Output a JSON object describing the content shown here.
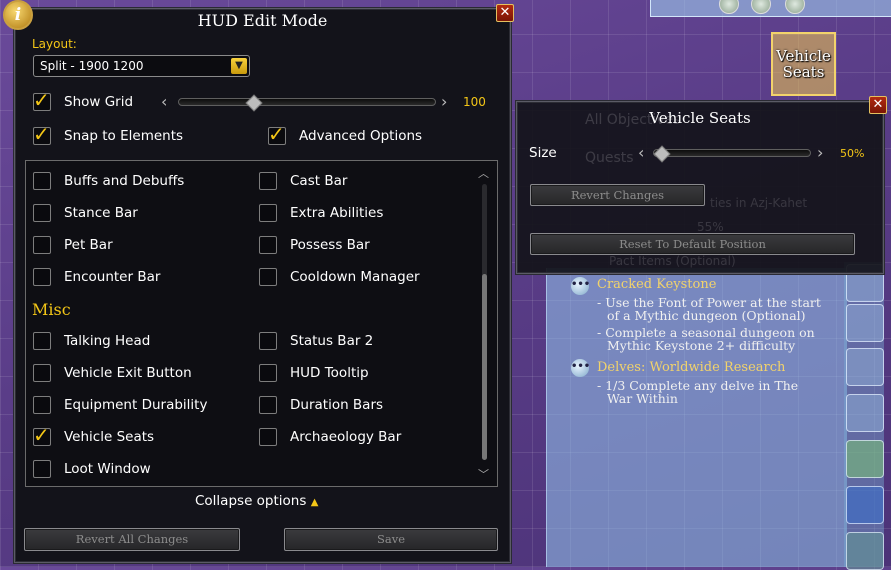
{
  "hud_panel": {
    "title": "HUD Edit Mode",
    "info_icon": "i",
    "close_icon": "✕",
    "layout_label": "Layout:",
    "layout_value": "Split - 1900 1200",
    "show_grid": {
      "label": "Show Grid",
      "checked": true,
      "value": "100",
      "level_fraction": 0.29
    },
    "snap_to_elements": {
      "label": "Snap to Elements",
      "checked": true
    },
    "advanced_options": {
      "label": "Advanced Options",
      "checked": true
    },
    "options_left": [
      {
        "label": "Buffs and Debuffs",
        "checked": false
      },
      {
        "label": "Stance Bar",
        "checked": false
      },
      {
        "label": "Pet Bar",
        "checked": false
      },
      {
        "label": "Encounter Bar",
        "checked": false
      }
    ],
    "options_right": [
      {
        "label": "Cast Bar",
        "checked": false
      },
      {
        "label": "Extra Abilities",
        "checked": false
      },
      {
        "label": "Possess Bar",
        "checked": false
      },
      {
        "label": "Cooldown Manager",
        "checked": false
      }
    ],
    "misc_heading": "Misc",
    "misc_left": [
      {
        "label": "Talking Head",
        "checked": false
      },
      {
        "label": "Vehicle Exit Button",
        "checked": false
      },
      {
        "label": "Equipment Durability",
        "checked": false
      },
      {
        "label": "Vehicle Seats",
        "checked": true
      },
      {
        "label": "Loot Window",
        "checked": false
      }
    ],
    "misc_right": [
      {
        "label": "Status Bar 2",
        "checked": false
      },
      {
        "label": "HUD Tooltip",
        "checked": false
      },
      {
        "label": "Duration Bars",
        "checked": false
      },
      {
        "label": "Archaeology Bar",
        "checked": false
      }
    ],
    "collapse_label": "Collapse options",
    "collapse_icon": "▲",
    "revert_all_label": "Revert All Changes",
    "save_label": "Save"
  },
  "vehicle_panel": {
    "title": "Vehicle Seats",
    "size_label": "Size",
    "size_value": "50%",
    "size_fraction": 0.0,
    "revert_label": "Revert Changes",
    "reset_label": "Reset To Default Position",
    "close_icon": "✕",
    "ghost_text_1": "All Objectives",
    "ghost_text_2": "Quests",
    "ghost_text_3": "ties in Azj-Kahet",
    "ghost_text_4": "55%",
    "ghost_text_5": "Pact Items (Optional)"
  },
  "widget": {
    "line1": "Vehicle",
    "line2": "Seats"
  },
  "tracker": {
    "items": [
      {
        "title": "Cracked Keystone",
        "lines": [
          "- Use the Font of Power at the start",
          "of a Mythic dungeon (Optional)",
          "- Complete a seasonal dungeon on",
          "Mythic Keystone 2+ difficulty"
        ]
      },
      {
        "title": "Delves: Worldwide Research",
        "lines": [
          "- 1/3 Complete any delve in The",
          "War Within"
        ]
      }
    ]
  },
  "colors": {
    "accent": "#f3c617",
    "panel_bg": "#13131a",
    "tracker_bg": "#96c8f0"
  }
}
